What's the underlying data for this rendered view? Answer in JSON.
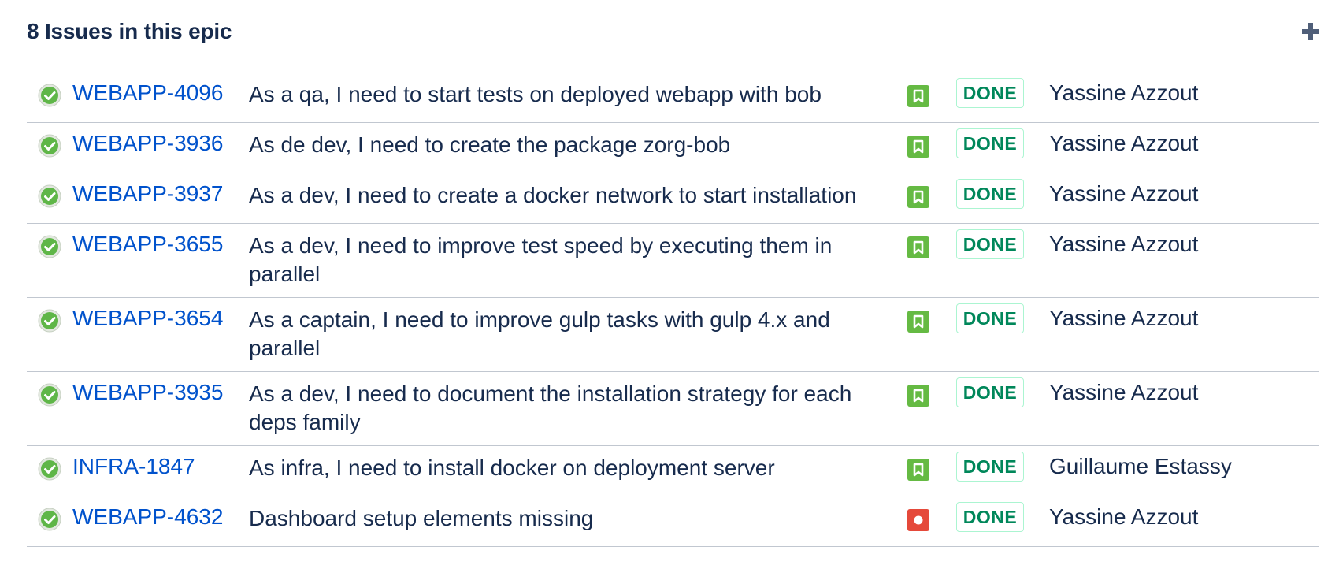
{
  "header": {
    "title": "8 Issues in this epic"
  },
  "colors": {
    "link": "#0052cc",
    "text": "#172b4d",
    "done_text": "#00875a",
    "done_border": "#abf5d1",
    "story_icon": "#65ba43",
    "bug_icon": "#e5493a",
    "resolved_icon": "#5fb648"
  },
  "issues": [
    {
      "key": "WEBAPP-4096",
      "summary": "As a qa, I need to start tests on deployed webapp with bob",
      "type": "story",
      "type_icon": "bookmark-icon",
      "status": "DONE",
      "assignee": "Yassine Azzout"
    },
    {
      "key": "WEBAPP-3936",
      "summary": "As de dev, I need to create the package zorg-bob",
      "type": "story",
      "type_icon": "bookmark-icon",
      "status": "DONE",
      "assignee": "Yassine Azzout"
    },
    {
      "key": "WEBAPP-3937",
      "summary": "As a dev, I need to create a docker network to start installation",
      "type": "story",
      "type_icon": "bookmark-icon",
      "status": "DONE",
      "assignee": "Yassine Azzout"
    },
    {
      "key": "WEBAPP-3655",
      "summary": "As a dev, I need to improve test speed by executing them in parallel",
      "type": "story",
      "type_icon": "bookmark-icon",
      "status": "DONE",
      "assignee": "Yassine Azzout"
    },
    {
      "key": "WEBAPP-3654",
      "summary": "As a captain, I need to improve gulp tasks with gulp 4.x and parallel",
      "type": "story",
      "type_icon": "bookmark-icon",
      "status": "DONE",
      "assignee": "Yassine Azzout"
    },
    {
      "key": "WEBAPP-3935",
      "summary": "As a dev, I need to document the installation strategy for each deps family",
      "type": "story",
      "type_icon": "bookmark-icon",
      "status": "DONE",
      "assignee": "Yassine Azzout"
    },
    {
      "key": "INFRA-1847",
      "summary": "As infra, I need to install docker on deployment server",
      "type": "story",
      "type_icon": "bookmark-icon",
      "status": "DONE",
      "assignee": "Guillaume Estassy"
    },
    {
      "key": "WEBAPP-4632",
      "summary": "Dashboard setup elements missing",
      "type": "bug",
      "type_icon": "bug-icon",
      "status": "DONE",
      "assignee": "Yassine Azzout"
    }
  ]
}
